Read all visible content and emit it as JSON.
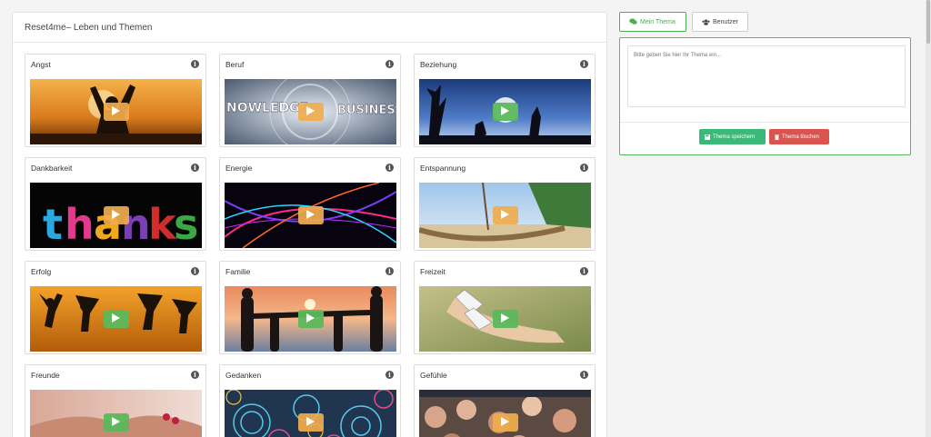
{
  "panel": {
    "title": "Reset4me– Leben und Themen"
  },
  "topics": [
    {
      "name": "Angst",
      "play": "orange"
    },
    {
      "name": "Beruf",
      "play": "orange"
    },
    {
      "name": "Beziehung",
      "play": "green"
    },
    {
      "name": "Dankbarkeit",
      "play": "orange"
    },
    {
      "name": "Energie",
      "play": "orange"
    },
    {
      "name": "Entspannung",
      "play": "orange"
    },
    {
      "name": "Erfolg",
      "play": "green"
    },
    {
      "name": "Familie",
      "play": "green"
    },
    {
      "name": "Freizeit",
      "play": "green"
    },
    {
      "name": "Freunde",
      "play": "green"
    },
    {
      "name": "Gedanken",
      "play": "orange"
    },
    {
      "name": "Gefühle",
      "play": "orange"
    }
  ],
  "tabs": {
    "my_topic": "Mein Thema",
    "users": "Benutzer"
  },
  "topic_form": {
    "placeholder": "Bitte geben Sie hier Ihr Thema ein...",
    "save_label": "Thema speichern",
    "delete_label": "Thema löschen"
  },
  "colors": {
    "accent_green": "#5cb85c",
    "save_green": "#3cb878",
    "danger_red": "#d9534f",
    "play_orange": "#f0ad4e"
  },
  "icons": {
    "info": "info-icon",
    "play": "play-icon",
    "comments": "comments-icon",
    "users": "users-icon",
    "save": "floppy-icon",
    "delete": "trash-icon"
  }
}
